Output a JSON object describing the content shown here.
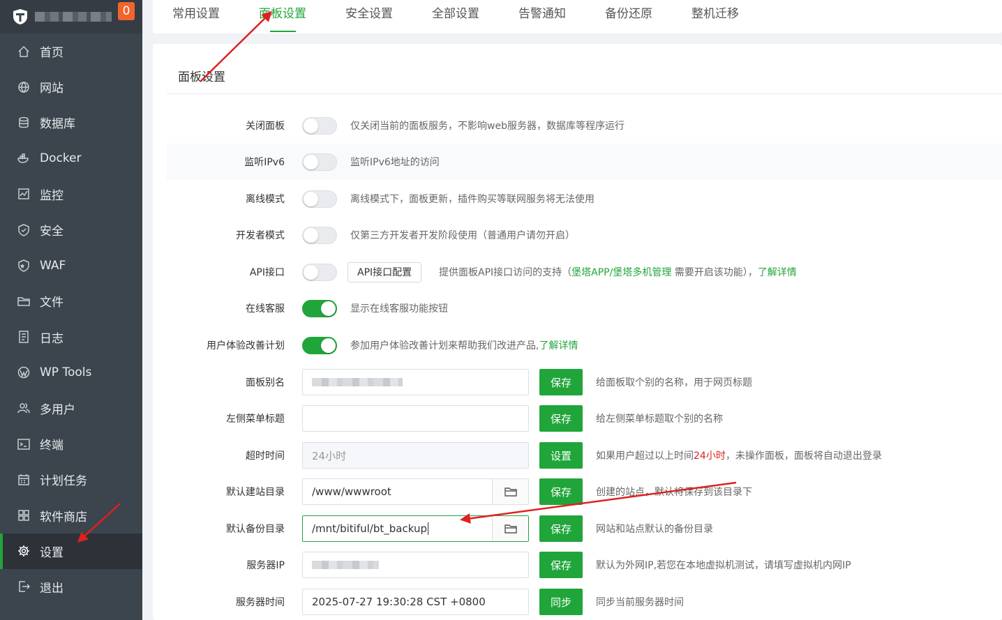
{
  "badge": "0",
  "nav": [
    {
      "label": "首页",
      "icon": "home-icon"
    },
    {
      "label": "网站",
      "icon": "globe-icon"
    },
    {
      "label": "数据库",
      "icon": "database-icon"
    },
    {
      "label": "Docker",
      "icon": "docker-icon"
    },
    {
      "label": "监控",
      "icon": "monitor-icon"
    },
    {
      "label": "安全",
      "icon": "shield-icon"
    },
    {
      "label": "WAF",
      "icon": "waf-icon"
    },
    {
      "label": "文件",
      "icon": "folder-icon"
    },
    {
      "label": "日志",
      "icon": "log-icon"
    },
    {
      "label": "WP Tools",
      "icon": "wordpress-icon"
    },
    {
      "label": "多用户",
      "icon": "users-icon"
    },
    {
      "label": "终端",
      "icon": "terminal-icon"
    },
    {
      "label": "计划任务",
      "icon": "calendar-icon"
    },
    {
      "label": "软件商店",
      "icon": "apps-icon"
    },
    {
      "label": "设置",
      "icon": "gear-icon"
    },
    {
      "label": "退出",
      "icon": "logout-icon"
    }
  ],
  "tabs": [
    "常用设置",
    "面板设置",
    "安全设置",
    "全部设置",
    "告警通知",
    "备份还原",
    "整机迁移"
  ],
  "section_title": "面板设置",
  "toggles": [
    {
      "label": "关闭面板",
      "desc": "仅关闭当前的面板服务，不影响web服务器，数据库等程序运行"
    },
    {
      "label": "监听IPv6",
      "desc": "监听IPv6地址的访问"
    },
    {
      "label": "离线模式",
      "desc": "离线模式下，面板更新，插件购买等联网服务将无法使用"
    },
    {
      "label": "开发者模式",
      "desc": "仅第三方开发者开发阶段使用（普通用户请勿开启）"
    },
    {
      "label": "API接口",
      "button": "API接口配置",
      "desc_pre": "提供面板API接口访问的支持（",
      "link1": "堡塔APP/",
      "link2": "堡塔多机管理",
      "desc_mid": " 需要开启该功能），",
      "link3": "了解详情"
    },
    {
      "label": "在线客服",
      "desc": "显示在线客服功能按钮"
    },
    {
      "label": "用户体验改善计划",
      "desc": "参加用户体验改善计划来帮助我们改进产品,",
      "link": "了解详情"
    }
  ],
  "fields": [
    {
      "label": "面板别名",
      "value": "",
      "button": "保存",
      "desc": "给面板取个别的名称，用于网页标题"
    },
    {
      "label": "左侧菜单标题",
      "value": "",
      "button": "保存",
      "desc": "给左侧菜单标题取个别的名称"
    },
    {
      "label": "超时时间",
      "value": "24小时",
      "button": "设置",
      "desc_pre": "如果用户超过以上时间",
      "desc_red": "24小时",
      "desc_post": "，未操作面板，面板将自动退出登录"
    },
    {
      "label": "默认建站目录",
      "value": "/www/wwwroot",
      "button": "保存",
      "desc": "创建的站点，默认将保存到该目录下"
    },
    {
      "label": "默认备份目录",
      "value": "/mnt/bitiful/bt_backup",
      "button": "保存",
      "desc": "网站和站点默认的备份目录"
    },
    {
      "label": "服务器IP",
      "value": "",
      "button": "保存",
      "desc": "默认为外网IP,若您在本地虚拟机测试，请填写虚拟机内网IP"
    },
    {
      "label": "服务器时间",
      "value": "2025-07-27 19:30:28 CST +0800",
      "button": "同步",
      "desc": "同步当前服务器时间"
    }
  ],
  "colors": {
    "accent": "#20a53a",
    "sidebar": "#3c444d",
    "arrow": "#e02020"
  }
}
